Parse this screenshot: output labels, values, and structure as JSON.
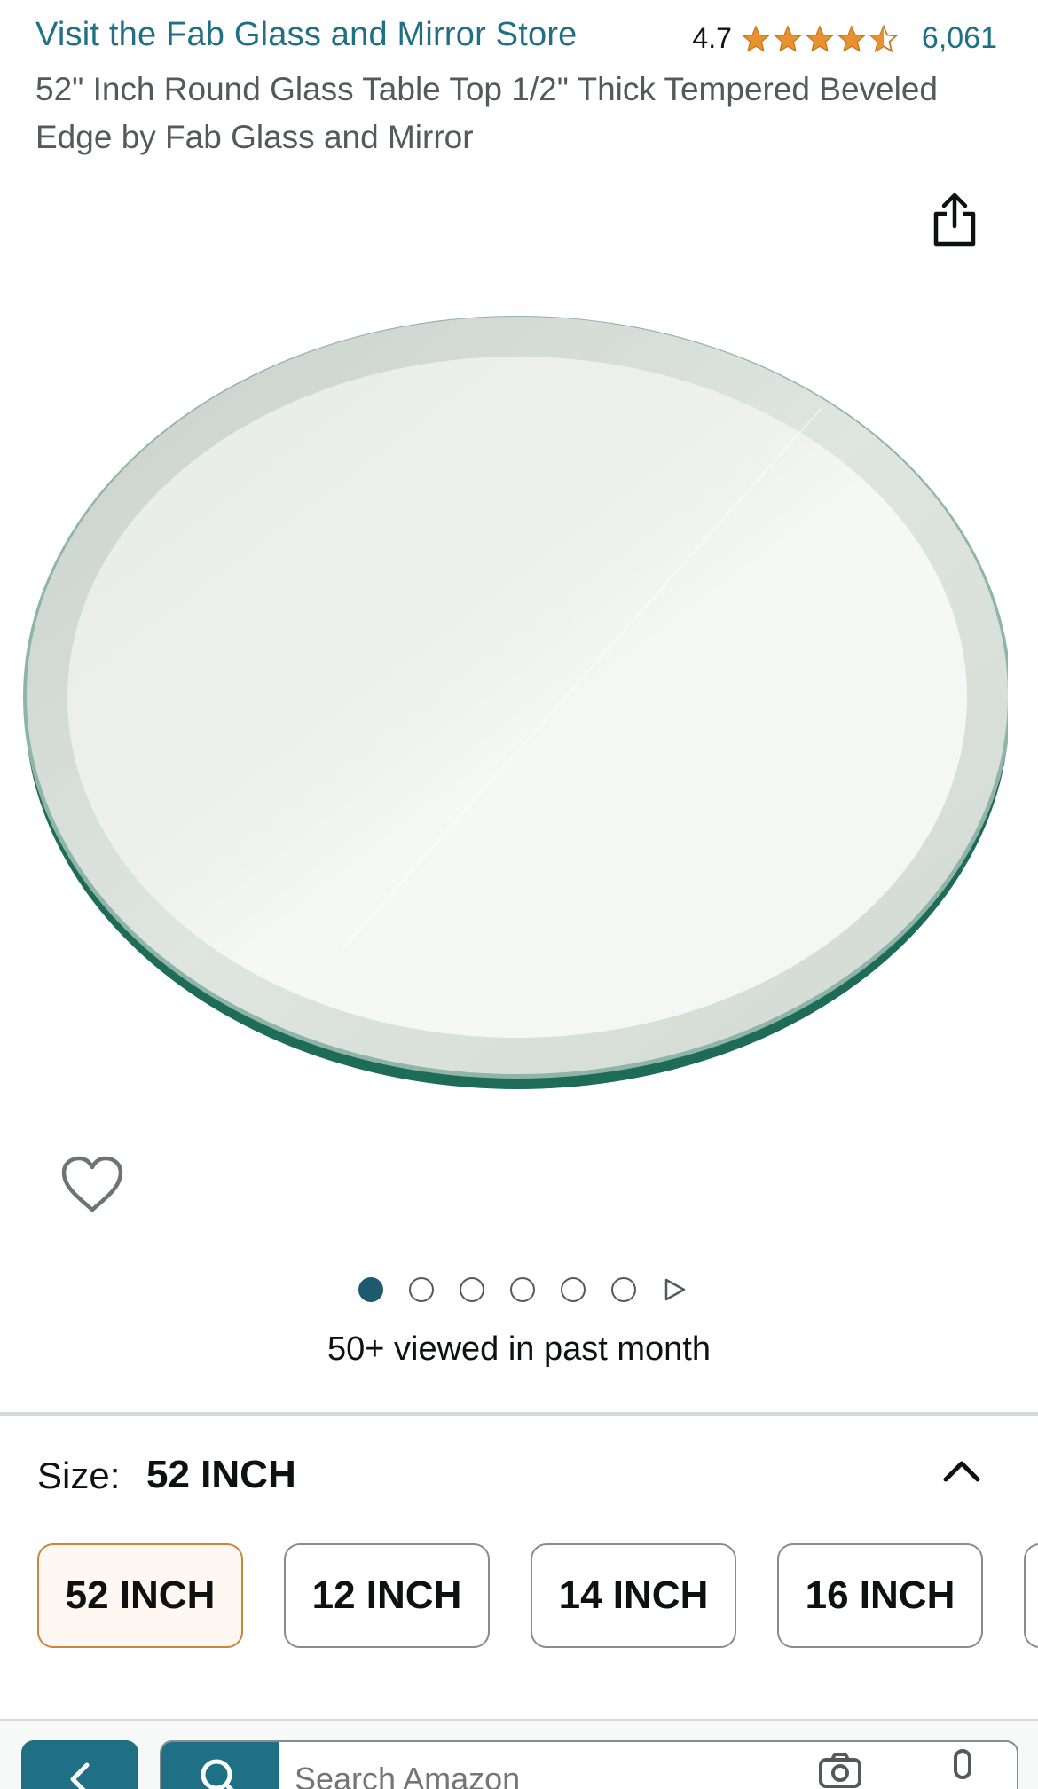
{
  "header": {
    "store_link": "Visit the Fab Glass and Mirror Store",
    "rating_value": "4.7",
    "rating_stars": 4.7,
    "rating_count": "6,061",
    "title": "52\" Inch Round Glass Table Top 1/2\" Thick Tempered Beveled Edge by Fab Glass and Mirror"
  },
  "icons": {
    "share": "share-icon",
    "wishlist": "heart-icon",
    "collapse": "chevron-up-icon",
    "back": "chevron-left-icon",
    "search": "search-icon",
    "camera": "camera-icon",
    "mic": "microphone-icon"
  },
  "carousel": {
    "image_count": 6,
    "active_index": 0,
    "has_video": true
  },
  "social_proof": "50+ viewed in past month",
  "size": {
    "label": "Size:",
    "selected_value": "52 INCH",
    "options": [
      "52 INCH",
      "12 INCH",
      "14 INCH",
      "16 INCH"
    ]
  },
  "search": {
    "placeholder": "Search Amazon"
  },
  "colors": {
    "link": "#1f6f85",
    "star": "#e8912d",
    "selected_border": "#c7873a",
    "nav_accent": "#1f6f85"
  }
}
